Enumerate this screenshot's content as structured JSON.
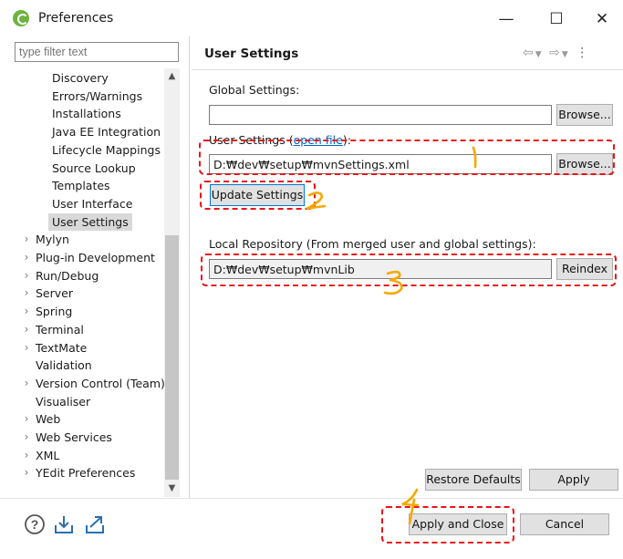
{
  "window": {
    "title": "Preferences",
    "minimize": "—",
    "maximize": "☐",
    "close": "✕"
  },
  "filter": {
    "placeholder": "type filter text"
  },
  "nav": {
    "items": [
      {
        "label": "Discovery",
        "expandable": false
      },
      {
        "label": "Errors/Warnings",
        "expandable": false
      },
      {
        "label": "Installations",
        "expandable": false
      },
      {
        "label": "Java EE Integration",
        "expandable": false
      },
      {
        "label": "Lifecycle Mappings",
        "expandable": false
      },
      {
        "label": "Source Lookup",
        "expandable": false
      },
      {
        "label": "Templates",
        "expandable": false
      },
      {
        "label": "User Interface",
        "expandable": false
      },
      {
        "label": "User Settings",
        "expandable": false,
        "selected": true
      },
      {
        "label": "Mylyn",
        "expandable": true
      },
      {
        "label": "Plug-in Development",
        "expandable": true
      },
      {
        "label": "Run/Debug",
        "expandable": true
      },
      {
        "label": "Server",
        "expandable": true
      },
      {
        "label": "Spring",
        "expandable": true
      },
      {
        "label": "Terminal",
        "expandable": true
      },
      {
        "label": "TextMate",
        "expandable": true
      },
      {
        "label": "Validation",
        "expandable": false
      },
      {
        "label": "Version Control (Team)",
        "expandable": true
      },
      {
        "label": "Visualiser",
        "expandable": false
      },
      {
        "label": "Web",
        "expandable": true
      },
      {
        "label": "Web Services",
        "expandable": true
      },
      {
        "label": "XML",
        "expandable": true
      },
      {
        "label": "YEdit Preferences",
        "expandable": true
      }
    ]
  },
  "page": {
    "title": "User Settings",
    "global_label": "Global Settings:",
    "global_value": "",
    "browse": "Browse...",
    "user_label": "User Settings (",
    "user_link": "open file",
    "user_label_end": "):",
    "user_value": "D:₩dev₩setup₩mvnSettings.xml",
    "update_settings": "Update Settings",
    "local_repo_label": "Local Repository (From merged user and global settings):",
    "local_repo_value": "D:₩dev₩setup₩mvnLib",
    "reindex": "Reindex",
    "restore_defaults": "Restore Defaults",
    "apply": "Apply"
  },
  "footer": {
    "apply_and_close": "Apply and Close",
    "cancel": "Cancel"
  },
  "annotations": {
    "marks": [
      "1",
      "2",
      "3",
      "4"
    ],
    "color_red": "#e8141a",
    "color_yellow": "#f5a800"
  }
}
